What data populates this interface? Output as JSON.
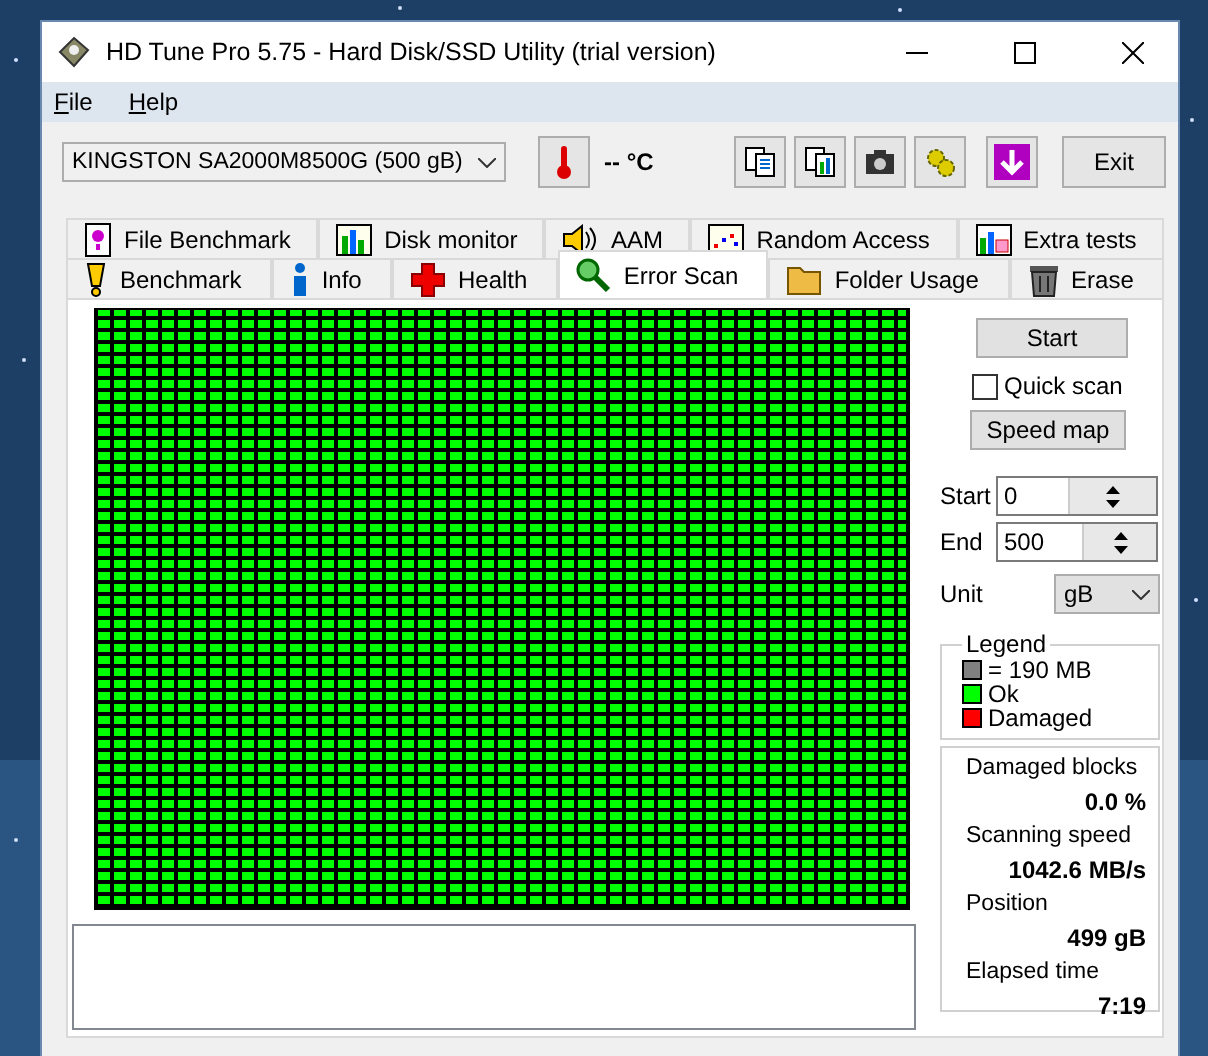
{
  "window": {
    "title": "HD Tune Pro 5.75 - Hard Disk/SSD Utility (trial version)"
  },
  "menu": [
    "File",
    "Help"
  ],
  "toolbar": {
    "drive": "KINGSTON SA2000M8500G (500 gB)",
    "temperature": "-- °C",
    "exit": "Exit"
  },
  "tabs_top": [
    {
      "label": "File Benchmark",
      "selected": false
    },
    {
      "label": "Disk monitor",
      "selected": false
    },
    {
      "label": "AAM",
      "selected": false
    },
    {
      "label": "Random Access",
      "selected": false
    },
    {
      "label": "Extra tests",
      "selected": false
    }
  ],
  "tabs_bottom": [
    {
      "label": "Benchmark",
      "selected": false
    },
    {
      "label": "Info",
      "selected": false
    },
    {
      "label": "Health",
      "selected": false
    },
    {
      "label": "Error Scan",
      "selected": true
    },
    {
      "label": "Folder Usage",
      "selected": false
    },
    {
      "label": "Erase",
      "selected": false
    }
  ],
  "error_scan": {
    "start_button": "Start",
    "quick_scan": {
      "label": "Quick scan",
      "checked": false
    },
    "speed_map_button": "Speed map",
    "start": {
      "label": "Start",
      "value": "0"
    },
    "end": {
      "label": "End",
      "value": "500"
    },
    "unit": {
      "label": "Unit",
      "value": "gB"
    },
    "legend": {
      "title": "Legend",
      "items": [
        {
          "label": "= 190 MB",
          "color": "#808080"
        },
        {
          "label": "Ok",
          "color": "#00ff00"
        },
        {
          "label": "Damaged",
          "color": "#ff0000"
        }
      ]
    },
    "stats": [
      {
        "label": "Damaged blocks",
        "value": "0.0 %"
      },
      {
        "label": "Scanning speed",
        "value": "1042.6 MB/s"
      },
      {
        "label": "Position",
        "value": "499 gB"
      },
      {
        "label": "Elapsed time",
        "value": "7:19"
      }
    ]
  }
}
